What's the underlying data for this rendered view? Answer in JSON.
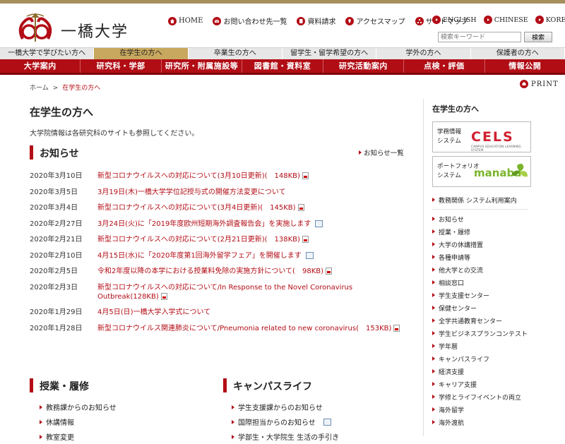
{
  "header": {
    "logo_text": "一橋大学",
    "util_links": [
      {
        "label": "HOME",
        "icon": "home-icon"
      },
      {
        "label": "お問い合わせ先一覧",
        "icon": "mail-icon"
      },
      {
        "label": "資料請求",
        "icon": "document-icon"
      },
      {
        "label": "アクセスマップ",
        "icon": "map-icon"
      },
      {
        "label": "サイトマップ",
        "icon": "sitemap-icon"
      }
    ],
    "languages": [
      "ENGLISH",
      "CHINESE",
      "KOREAN"
    ],
    "search": {
      "placeholder": "検索キーワード",
      "button": "検索"
    }
  },
  "audience_nav": [
    {
      "label": "一橋大学で学びたい方へ",
      "active": false
    },
    {
      "label": "在学生の方へ",
      "active": true
    },
    {
      "label": "卒業生の方へ",
      "active": false
    },
    {
      "label": "留学生・留学希望の方へ",
      "active": false
    },
    {
      "label": "学外の方へ",
      "active": false
    },
    {
      "label": "保護者の方へ",
      "active": false
    }
  ],
  "main_nav": [
    "大学案内",
    "研究科・学部",
    "研究所・附属施設等",
    "図書館・資料室",
    "研究活動案内",
    "点検・評価",
    "情報公開"
  ],
  "breadcrumb": {
    "home": "ホーム",
    "separator": ">",
    "current": "在学生の方へ"
  },
  "print_label": "PRINT",
  "page": {
    "title": "在学生の方へ",
    "intro": "大学院情報は各研究科のサイトも参照してください。"
  },
  "news": {
    "heading": "お知らせ",
    "more": "お知らせ一覧",
    "items": [
      {
        "date": "2020年3月10日",
        "title": "新型コロナウイルスへの対応について(3月10日更新)(　148KB)",
        "icon": "pdf"
      },
      {
        "date": "2020年3月5日",
        "title": "3月19日(木)一橋大学学位記授与式の開催方法変更について",
        "icon": ""
      },
      {
        "date": "2020年3月4日",
        "title": "新型コロナウイルスへの対応について(3月4日更新)(　145KB)",
        "icon": "pdf"
      },
      {
        "date": "2020年2月27日",
        "title": "3月24日(火)に「2019年度欧州短期海外調査報告会」を実施します",
        "icon": "doc"
      },
      {
        "date": "2020年2月21日",
        "title": "新型コロナウイルスへの対応について(2月21日更新)(　138KB)",
        "icon": "pdf"
      },
      {
        "date": "2020年2月10日",
        "title": "4月15日(水)に「2020年度第1回海外留学フェア」を開催します",
        "icon": "doc"
      },
      {
        "date": "2020年2月5日",
        "title": "令和2年度以降の本学における授業料免除の実施方針について(　98KB)",
        "icon": "pdf"
      },
      {
        "date": "2020年2月3日",
        "title": "新型コロナウイルスへの対応について/In Response to the Novel Coronavirus Outbreak(128KB)",
        "icon": "pdf"
      },
      {
        "date": "2020年1月29日",
        "title": "4月5日(日)一橋大学入学式について",
        "icon": ""
      },
      {
        "date": "2020年1月28日",
        "title": "新型コロナウイルス関連肺炎について/Pneumonia related to new coronavirus(　153KB)",
        "icon": "pdf"
      }
    ]
  },
  "classes": {
    "heading": "授業・履修",
    "items": [
      "教務課からのお知らせ",
      "休講情報",
      "教室変更"
    ]
  },
  "campus": {
    "heading": "キャンパスライフ",
    "items": [
      "学生支援課からのお知らせ",
      "国際担当からのお知らせ",
      "学部生・大学院生 生活の手引き"
    ]
  },
  "sidebar": {
    "title": "在学生の方へ",
    "banner_cels": {
      "label_line1": "学務情報",
      "label_line2": "システム",
      "logo": "CELS",
      "sub": "CAMPUS EDUCATION LEARNING SYSTEM"
    },
    "banner_manaba": {
      "label_line1": "ポートフォリオ",
      "label_line2": "システム",
      "logo": "manaba"
    },
    "top_link": "教務関係 システム利用案内",
    "links": [
      "お知らせ",
      "授業・履修",
      "大学の休講措置",
      "各種申請等",
      "他大学との交流",
      "相談窓口",
      "学生支援センター",
      "保健センター",
      "全学共通教育センター",
      "学生ビジネスプランコンテスト",
      "学年暦",
      "キャンパスライフ",
      "経済支援",
      "キャリア支援",
      "学修とライフイベントの両立",
      "海外留学",
      "海外渡航"
    ]
  },
  "colors": {
    "accent": "#b10d15",
    "gold": "#c8a85e"
  }
}
